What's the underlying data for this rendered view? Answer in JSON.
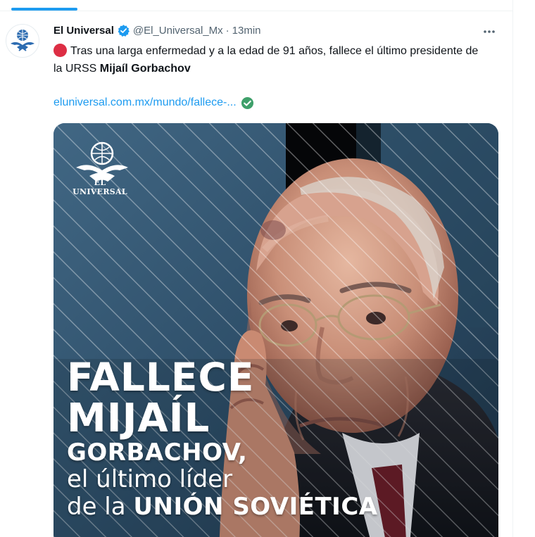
{
  "tweet": {
    "display_name": "El Universal",
    "handle": "@El_Universal_Mx",
    "separator": "·",
    "timestamp": "13min",
    "text_before_bold": "Tras una larga enfermedad y a la edad de 91 años, fallece el último presidente de la URSS ",
    "text_bold": "Mijaíl Gorbachov",
    "link": "eluniversal.com.mx/mundo/fallece-..."
  },
  "media": {
    "brand_name": "EL UNIVERSAL",
    "headline_line1": "FALLECE",
    "headline_line2": "MIJAÍL",
    "headline_line3": "GORBACHOV,",
    "headline_line4": "el último líder",
    "headline_line5_prefix": "de la ",
    "headline_line5_bold": "UNIÓN SOVIÉTICA"
  },
  "icons": {
    "verified": "verified-badge-icon",
    "more": "more-options-icon",
    "red_circle": "red-circle-emoji",
    "check": "green-check-icon",
    "avatar": "el-universal-logo-icon"
  },
  "colors": {
    "accent": "#1d9bf0",
    "text": "#0f1419",
    "muted": "#536471",
    "red_circle": "#dd2e44",
    "check_green": "#3fa06a"
  }
}
